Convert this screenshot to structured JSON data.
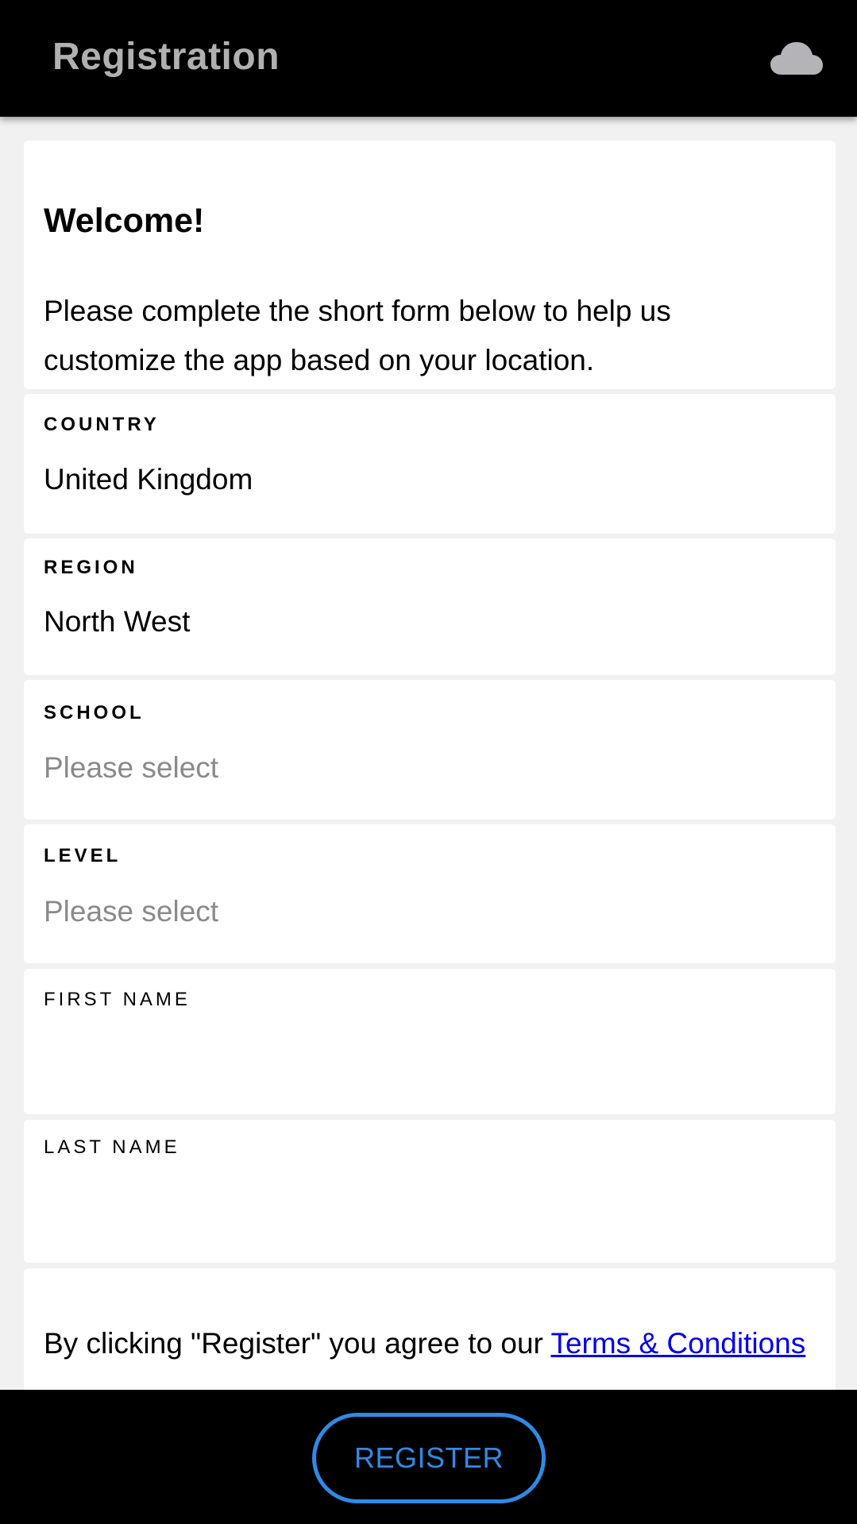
{
  "header": {
    "title": "Registration",
    "cloud_icon": "cloud-icon"
  },
  "welcome": {
    "title": "Welcome!",
    "message": "Please complete the short form below to help us customize the app based on your location."
  },
  "fields": {
    "country": {
      "label": "COUNTRY",
      "value": "United Kingdom"
    },
    "region": {
      "label": "REGION",
      "value": "North West"
    },
    "school": {
      "label": "SCHOOL",
      "placeholder": "Please select"
    },
    "level": {
      "label": "LEVEL",
      "placeholder": "Please select"
    },
    "first_name": {
      "label": "FIRST NAME",
      "value": ""
    },
    "last_name": {
      "label": "LAST NAME",
      "value": ""
    }
  },
  "terms": {
    "prefix": "By clicking \"Register\" you agree to our ",
    "link_text": "Terms & Conditions"
  },
  "footer": {
    "register_label": "REGISTER"
  },
  "colors": {
    "header_bg": "#000000",
    "header_title": "#b0b0b0",
    "page_bg": "#f1f1f1",
    "card_bg": "#ffffff",
    "placeholder": "#8a8a8a",
    "link": "#0000ee",
    "button_accent": "#2f8ae6"
  }
}
